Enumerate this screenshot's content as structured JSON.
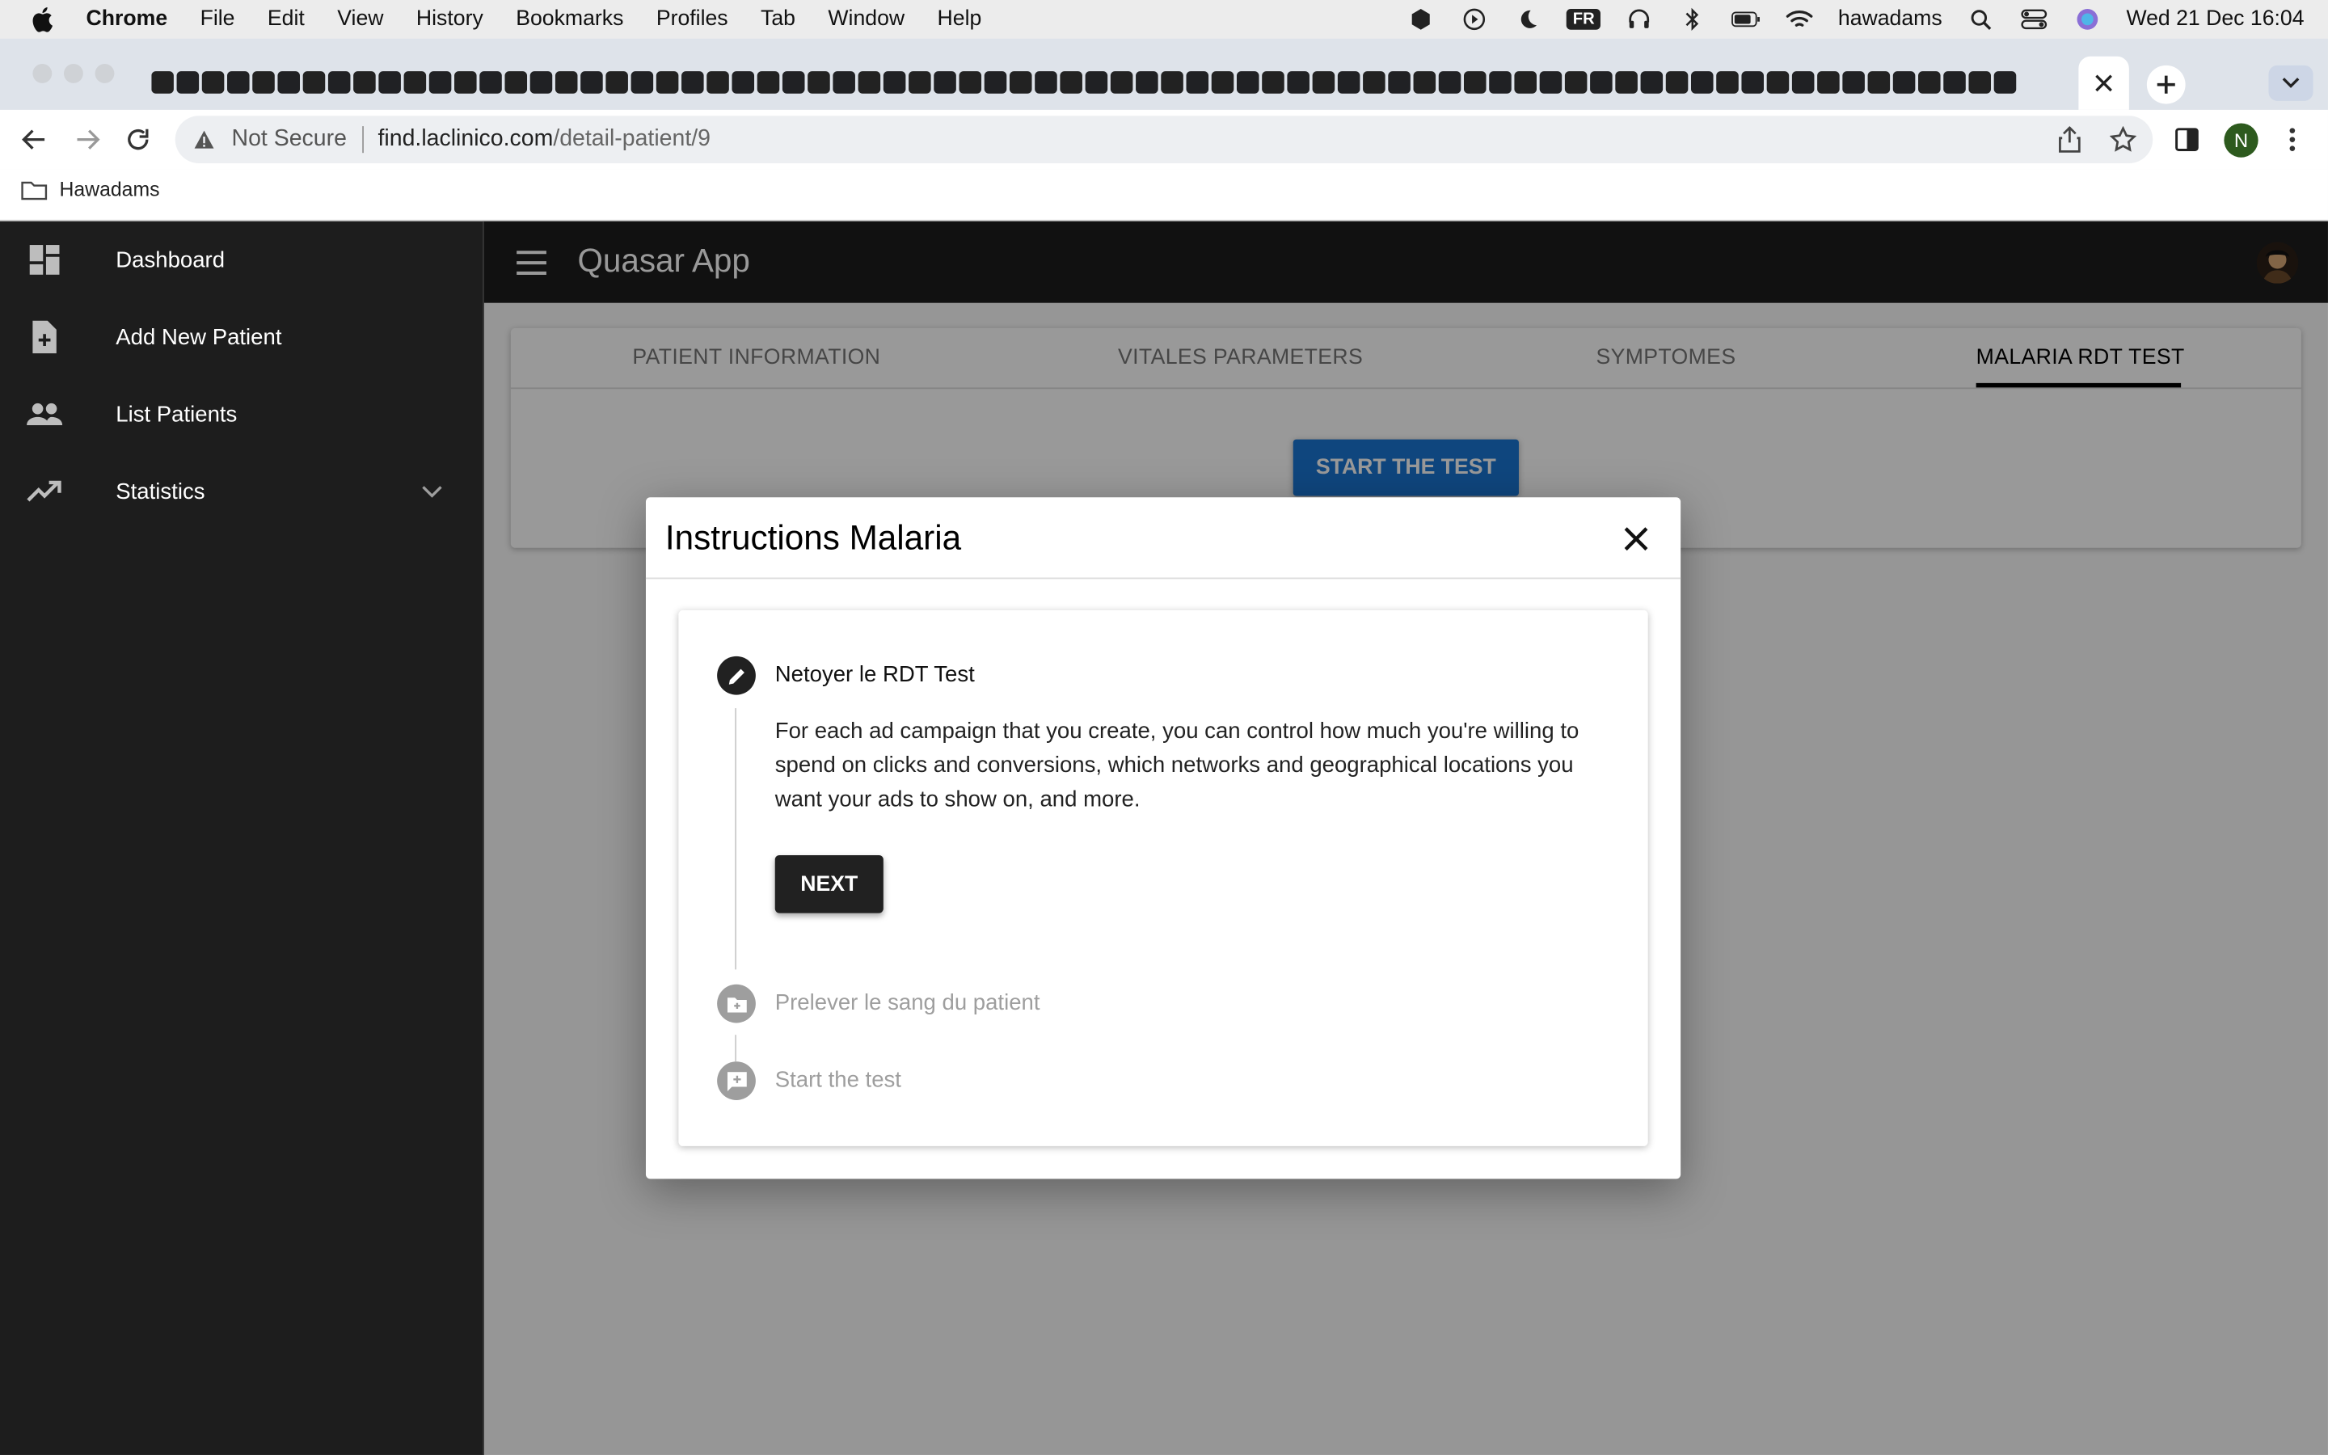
{
  "menubar": {
    "app": "Chrome",
    "items": [
      "File",
      "Edit",
      "View",
      "History",
      "Bookmarks",
      "Profiles",
      "Tab",
      "Window",
      "Help"
    ],
    "input_source": "FR",
    "user": "hawadams",
    "datetime": "Wed 21 Dec  16:04"
  },
  "browser": {
    "security_label": "Not Secure",
    "url_host": "find.laclinico.com",
    "url_path": "/detail-patient/9",
    "profile_initial": "N",
    "bookmark_folder": "Hawadams"
  },
  "app": {
    "title": "Quasar App",
    "nav": [
      {
        "label": "Dashboard",
        "icon": "dashboard-icon"
      },
      {
        "label": "Add New Patient",
        "icon": "note-add-icon"
      },
      {
        "label": "List Patients",
        "icon": "people-icon"
      },
      {
        "label": "Statistics",
        "icon": "trending-up-icon"
      }
    ],
    "tabs": [
      "PATIENT INFORMATION",
      "VITALES PARAMETERS",
      "SYMPTOMES",
      "MALARIA RDT TEST"
    ],
    "active_tab": "MALARIA RDT TEST",
    "start_button": "START THE TEST"
  },
  "dialog": {
    "title": "Instructions Malaria",
    "steps": [
      {
        "title": "Netoyer le RDT Test",
        "state": "active",
        "icon": "edit-icon"
      },
      {
        "title": "Prelever le sang du patient",
        "state": "inactive",
        "icon": "create-new-folder-icon"
      },
      {
        "title": "Start the test",
        "state": "inactive",
        "icon": "add-comment-icon"
      }
    ],
    "body": "For each ad campaign that you create, you can control how much you're willing to spend on clicks and conversions, which networks and geographical locations you want your ads to show on, and more.",
    "next_button": "NEXT"
  },
  "colors": {
    "primary": "#1976d2",
    "dark": "#1d1d1d",
    "active_step": "#212121",
    "inactive_step": "#9e9e9e"
  }
}
